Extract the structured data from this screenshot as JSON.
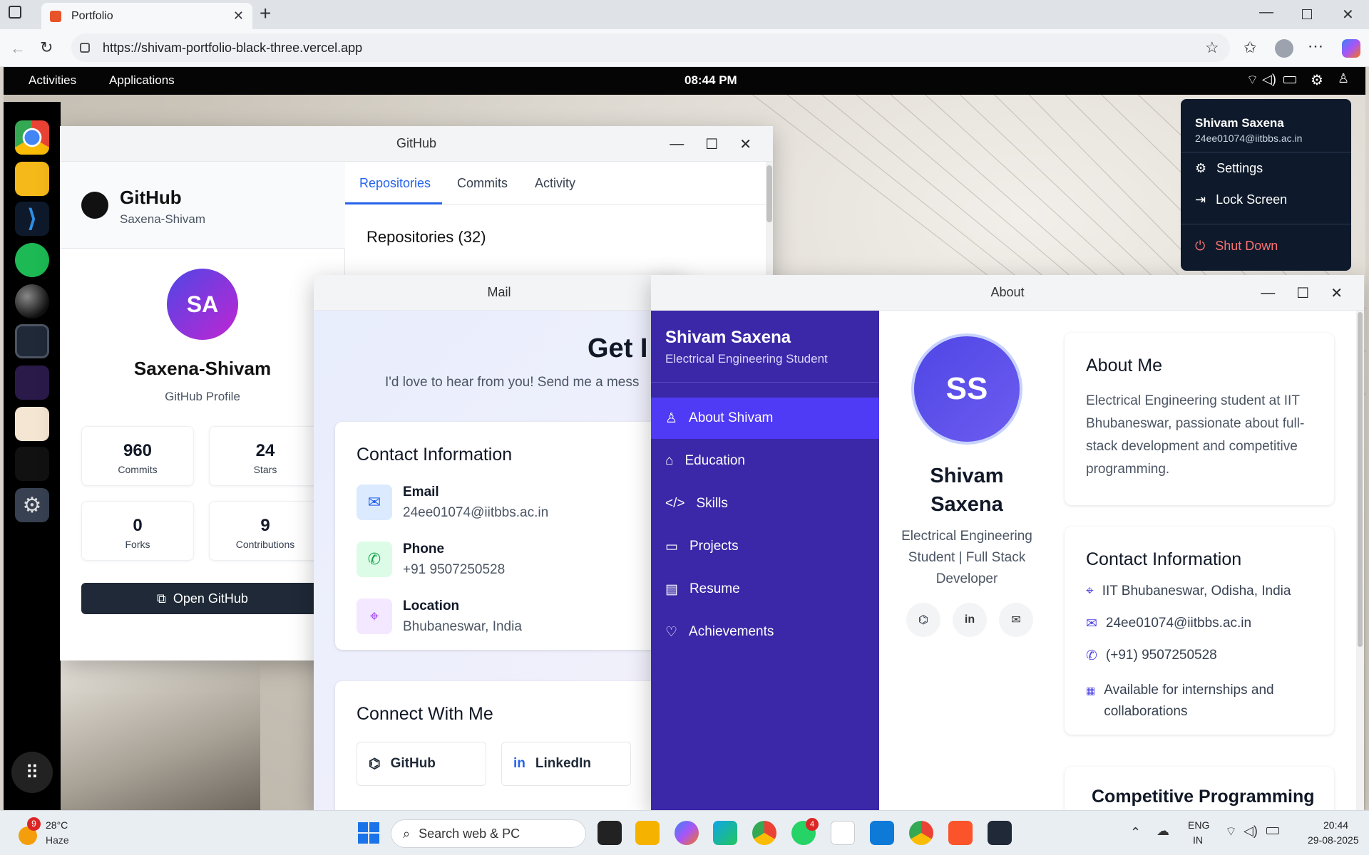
{
  "browser": {
    "tab_title": "Portfolio",
    "url": "https://shivam-portfolio-black-three.vercel.app"
  },
  "topbar": {
    "activities": "Activities",
    "applications": "Applications",
    "clock": "08:44 PM"
  },
  "user_menu": {
    "name": "Shivam Saxena",
    "email": "24ee01074@iitbbs.ac.in",
    "settings": "Settings",
    "lock": "Lock Screen",
    "shutdown": "Shut Down"
  },
  "github_window": {
    "title": "GitHub",
    "brand": "GitHub",
    "username": "Saxena-Shivam",
    "avatar_initials": "SA",
    "profile_name": "Saxena-Shivam",
    "profile_label": "GitHub Profile",
    "stats": [
      {
        "value": "960",
        "label": "Commits"
      },
      {
        "value": "24",
        "label": "Stars"
      },
      {
        "value": "0",
        "label": "Forks"
      },
      {
        "value": "9",
        "label": "Contributions"
      }
    ],
    "open_button": "Open GitHub",
    "tabs": [
      "Repositories",
      "Commits",
      "Activity"
    ],
    "repos_heading": "Repositories (32)"
  },
  "mail_window": {
    "title": "Mail",
    "heading": "Get I",
    "subheading": "I'd love to hear from you! Send me a mess",
    "contact_heading": "Contact Information",
    "contacts": [
      {
        "label": "Email",
        "value": "24ee01074@iitbbs.ac.in"
      },
      {
        "label": "Phone",
        "value": "+91 9507250528"
      },
      {
        "label": "Location",
        "value": "Bhubaneswar, India"
      }
    ],
    "connect_heading": "Connect With Me",
    "connect_buttons": [
      "GitHub",
      "LinkedIn"
    ]
  },
  "about_window": {
    "title": "About",
    "sidebar_name": "Shivam Saxena",
    "sidebar_role": "Electrical Engineering Student",
    "nav": [
      "About Shivam",
      "Education",
      "Skills",
      "Projects",
      "Resume",
      "Achievements"
    ],
    "avatar_initials": "SS",
    "profile_name_line1": "Shivam",
    "profile_name_line2": "Saxena",
    "profile_role_line1": "Electrical Engineering",
    "profile_role_line2": "Student | Full Stack",
    "profile_role_line3": "Developer",
    "about_heading": "About Me",
    "about_text": "Electrical Engineering student at IIT Bhubaneswar, passionate about full-stack development and competitive programming.",
    "contact_heading": "Contact Information",
    "contact_items": [
      "IIT Bhubaneswar, Odisha, India",
      "24ee01074@iitbbs.ac.in",
      "(+91) 9507250528",
      "Available for internships and collaborations"
    ],
    "cp_heading": "Competitive Programming"
  },
  "taskbar": {
    "weather_temp": "28°C",
    "weather_desc": "Haze",
    "weather_badge": "9",
    "search_placeholder": "Search web & PC",
    "whatsapp_badge": "4",
    "lang1": "ENG",
    "lang2": "IN",
    "time": "20:44",
    "date": "29-08-2025"
  },
  "colors": {
    "about_sidebar": "#3a28a8",
    "nav_active": "#4f3af5",
    "accent_blue": "#2563eb",
    "dark_button": "#1f2937",
    "shutdown_red": "#f87171"
  }
}
